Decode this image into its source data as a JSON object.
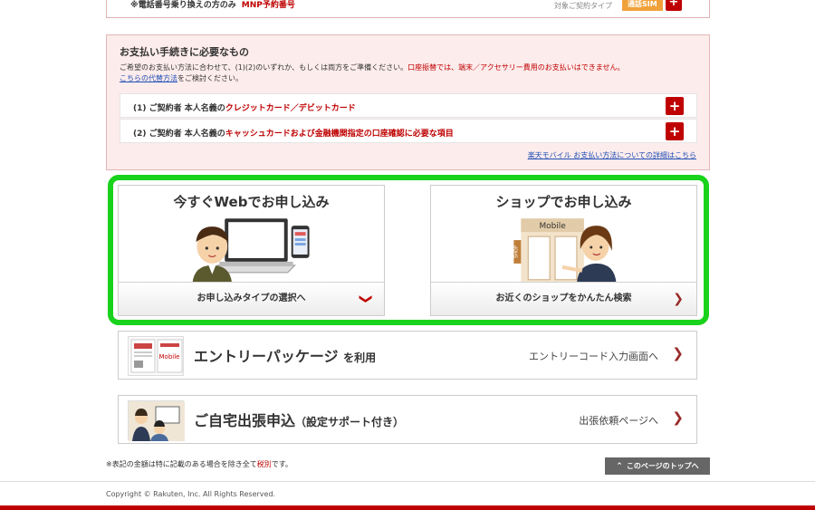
{
  "top_row": {
    "note": "※電話番号乗り換えの方のみ",
    "mnp": "MNP予約番号",
    "type_label": "対象ご契約タイプ",
    "badge": "通話SIM",
    "plus": "+"
  },
  "payment": {
    "title": "お支払い手続きに必要なもの",
    "desc_main": "ご希望のお支払い方法に合わせて、(1)(2)のいずれか、もしくは両方をご準備ください。",
    "desc_red": "口座振替では、端末／アクセサリー費用のお支払いはできません。",
    "desc_link": "こちらの代替方法",
    "desc_tail": "をご検討ください。",
    "items": [
      {
        "prefix": "(1) ご契約者 本人名義の",
        "red": "クレジットカード／デビットカード",
        "suffix": "",
        "plus": "+"
      },
      {
        "prefix": "(2) ご契約者 本人名義の",
        "red": "キャッシュカードおよび金融機関指定の口座確認に必要な項目",
        "suffix": "",
        "plus": "+"
      }
    ],
    "detail_link": "楽天モバイル お支払い方法についての詳細はこちら"
  },
  "apply": {
    "web": {
      "title": "今すぐWebでお申し込み",
      "button": "お申し込みタイプの選択へ",
      "chevron": "❯"
    },
    "shop": {
      "title": "ショップでお申し込み",
      "button": "お近くのショップをかんたん検索",
      "chevron": "❯",
      "sign": "Mobile",
      "shop_label": "SHOP"
    }
  },
  "entry": {
    "title": "エントリーパッケージ",
    "suffix": "を利用",
    "link": "エントリーコード入力画面へ",
    "arrow": "❯",
    "thumb_text": "Mobile"
  },
  "home": {
    "title": "ご自宅出張申込",
    "suffix": "（設定サポート付き）",
    "link": "出張依頼ページへ",
    "arrow": "❯"
  },
  "footer": {
    "tax_note_pre": "※表記の金額は特に記載のある場合を除き全て",
    "tax_note_red": "税別",
    "tax_note_post": "です。",
    "to_top": "このページのトップへ",
    "to_top_icon": "⌃",
    "copyright": "Copyright © Rakuten, Inc. All Rights Reserved."
  },
  "colors": {
    "accent_red": "#bf0000",
    "highlight_green": "#19d21c",
    "badge_orange": "#f0a23a",
    "pay_bg": "#fdecec"
  }
}
